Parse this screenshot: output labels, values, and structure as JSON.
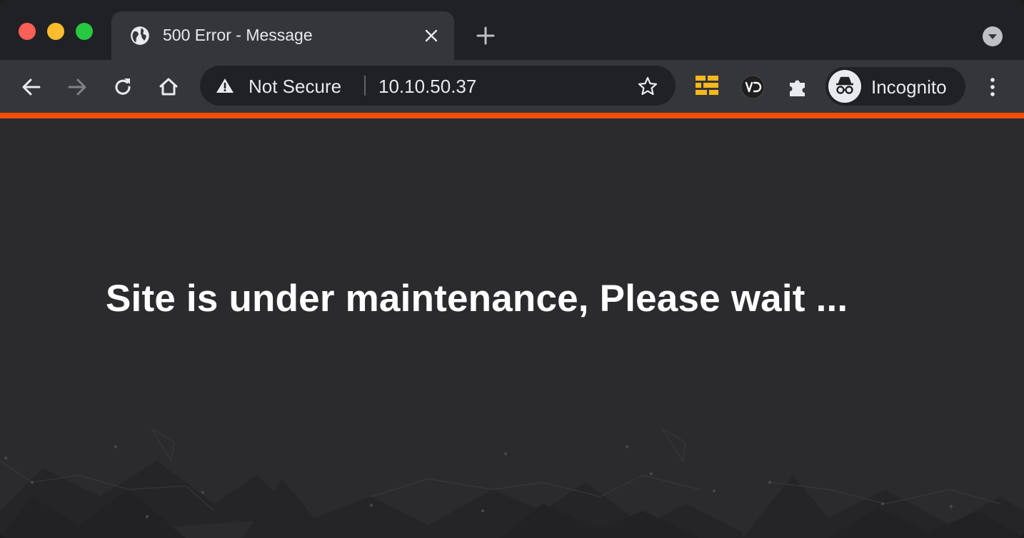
{
  "window": {
    "controls": [
      "close",
      "minimize",
      "zoom"
    ]
  },
  "tab": {
    "title": "500 Error - Message",
    "favicon": "globe-icon"
  },
  "toolbar": {
    "back_icon": "arrow-left-icon",
    "forward_icon": "arrow-right-icon",
    "reload_icon": "reload-icon",
    "home_icon": "home-icon",
    "security_label": "Not Secure",
    "url": "10.10.50.37",
    "bookmark_icon": "star-icon",
    "extensions": [
      "grid-extension-icon",
      "vd-extension-icon",
      "puzzle-icon"
    ],
    "profile_label": "Incognito",
    "menu_icon": "kebab-menu-icon"
  },
  "page": {
    "message": "Site is under maintenance, Please wait ..."
  },
  "colors": {
    "accent_bar": "#f04e00",
    "content_bg": "#2b2b2e",
    "toolbar_bg": "#35363a",
    "tabstrip_bg": "#202124"
  }
}
